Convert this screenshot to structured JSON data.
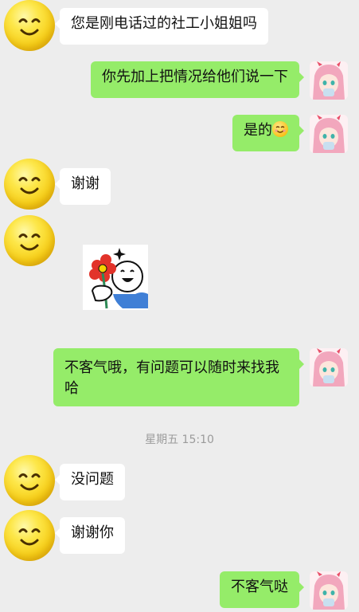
{
  "colors": {
    "background": "#ededed",
    "outgoing_bubble": "#95ec69",
    "incoming_bubble": "#ffffff",
    "timestamp": "#9b9b9b"
  },
  "messages": [
    {
      "side": "left",
      "text": "您是刚电话过的社工小姐姐吗"
    },
    {
      "side": "right",
      "text": "你先加上把情况给他们说一下"
    },
    {
      "side": "right",
      "text": "是的",
      "emoji": "smiling-face-emoji"
    },
    {
      "side": "left",
      "text": "谢谢"
    },
    {
      "side": "left",
      "sticker": "flower-sticker"
    },
    {
      "side": "right",
      "text": "不客气哦，有问题可以随时来找我哈"
    },
    {
      "side": "left",
      "text": "没问题"
    },
    {
      "side": "left",
      "text": "谢谢你"
    },
    {
      "side": "right",
      "text": "不客气哒"
    }
  ],
  "timestamp": "星期五 15:10",
  "icons": {
    "contact_avatar": "smiley-face-icon",
    "self_avatar": "anime-girl-avatar-icon"
  }
}
